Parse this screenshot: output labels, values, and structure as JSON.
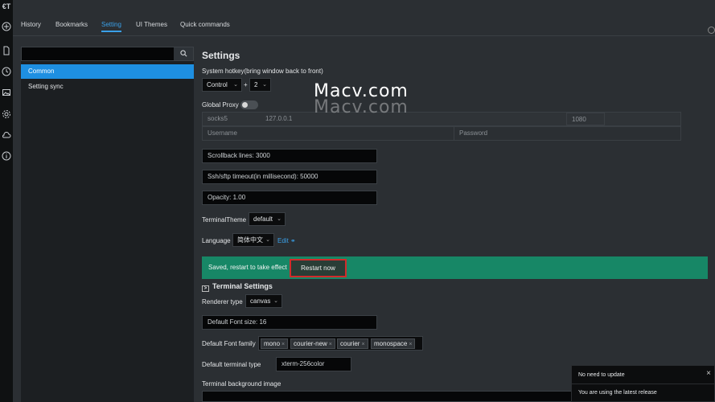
{
  "app": {
    "logo": "€T"
  },
  "leftbar": {
    "icons": [
      "plus-circle-icon",
      "file-icon",
      "clock-icon",
      "image-icon",
      "gear-icon",
      "cloud-icon",
      "info-icon"
    ]
  },
  "tabs": [
    {
      "label": "History"
    },
    {
      "label": "Bookmarks"
    },
    {
      "label": "Setting",
      "active": true
    },
    {
      "label": "UI Themes"
    },
    {
      "label": "Quick commands"
    }
  ],
  "sidebar": {
    "search": {
      "value": "",
      "placeholder": ""
    },
    "items": [
      {
        "label": "Common",
        "active": true
      },
      {
        "label": "Setting sync"
      }
    ]
  },
  "settings": {
    "title": "Settings",
    "hotkey": {
      "label": "System hotkey(bring window back to front)",
      "modifier": "Control",
      "plus": "+",
      "key": "2"
    },
    "proxy": {
      "label": "Global Proxy",
      "enabled": false,
      "type": "socks5",
      "host": "127.0.0.1",
      "port": "1080",
      "username_placeholder": "Username",
      "password_placeholder": "Password"
    },
    "fields": {
      "scrollback": "Scrollback lines: 3000",
      "timeout": "Ssh/sftp timeout(in millisecond): 50000",
      "opacity": "Opacity: 1.00"
    },
    "terminal_theme": {
      "label": "TerminalTheme",
      "value": "default"
    },
    "language": {
      "label": "Language",
      "value": "简体中文",
      "edit": "Edit"
    },
    "banner": {
      "message": "Saved, restart to take effect",
      "button": "Restart now",
      "color": "#178766"
    },
    "terminal_settings": {
      "title": "Terminal Settings",
      "renderer": {
        "label": "Renderer type",
        "value": "canvas"
      },
      "font_size": "Default Font size: 16",
      "font_family": {
        "label": "Default Font family",
        "chips": [
          "mono",
          "courier-new",
          "courier",
          "monospace"
        ]
      },
      "terminal_type": {
        "label": "Default terminal type",
        "value": "xterm-256color"
      },
      "bg_image": {
        "label": "Terminal background image"
      }
    }
  },
  "watermark": {
    "text": "Macv.com"
  },
  "toast": {
    "title": "No need to update",
    "message": "You are using the latest release",
    "close": "×"
  },
  "colors": {
    "accent": "#3aa0e8",
    "highlight": "#d22b2b"
  }
}
